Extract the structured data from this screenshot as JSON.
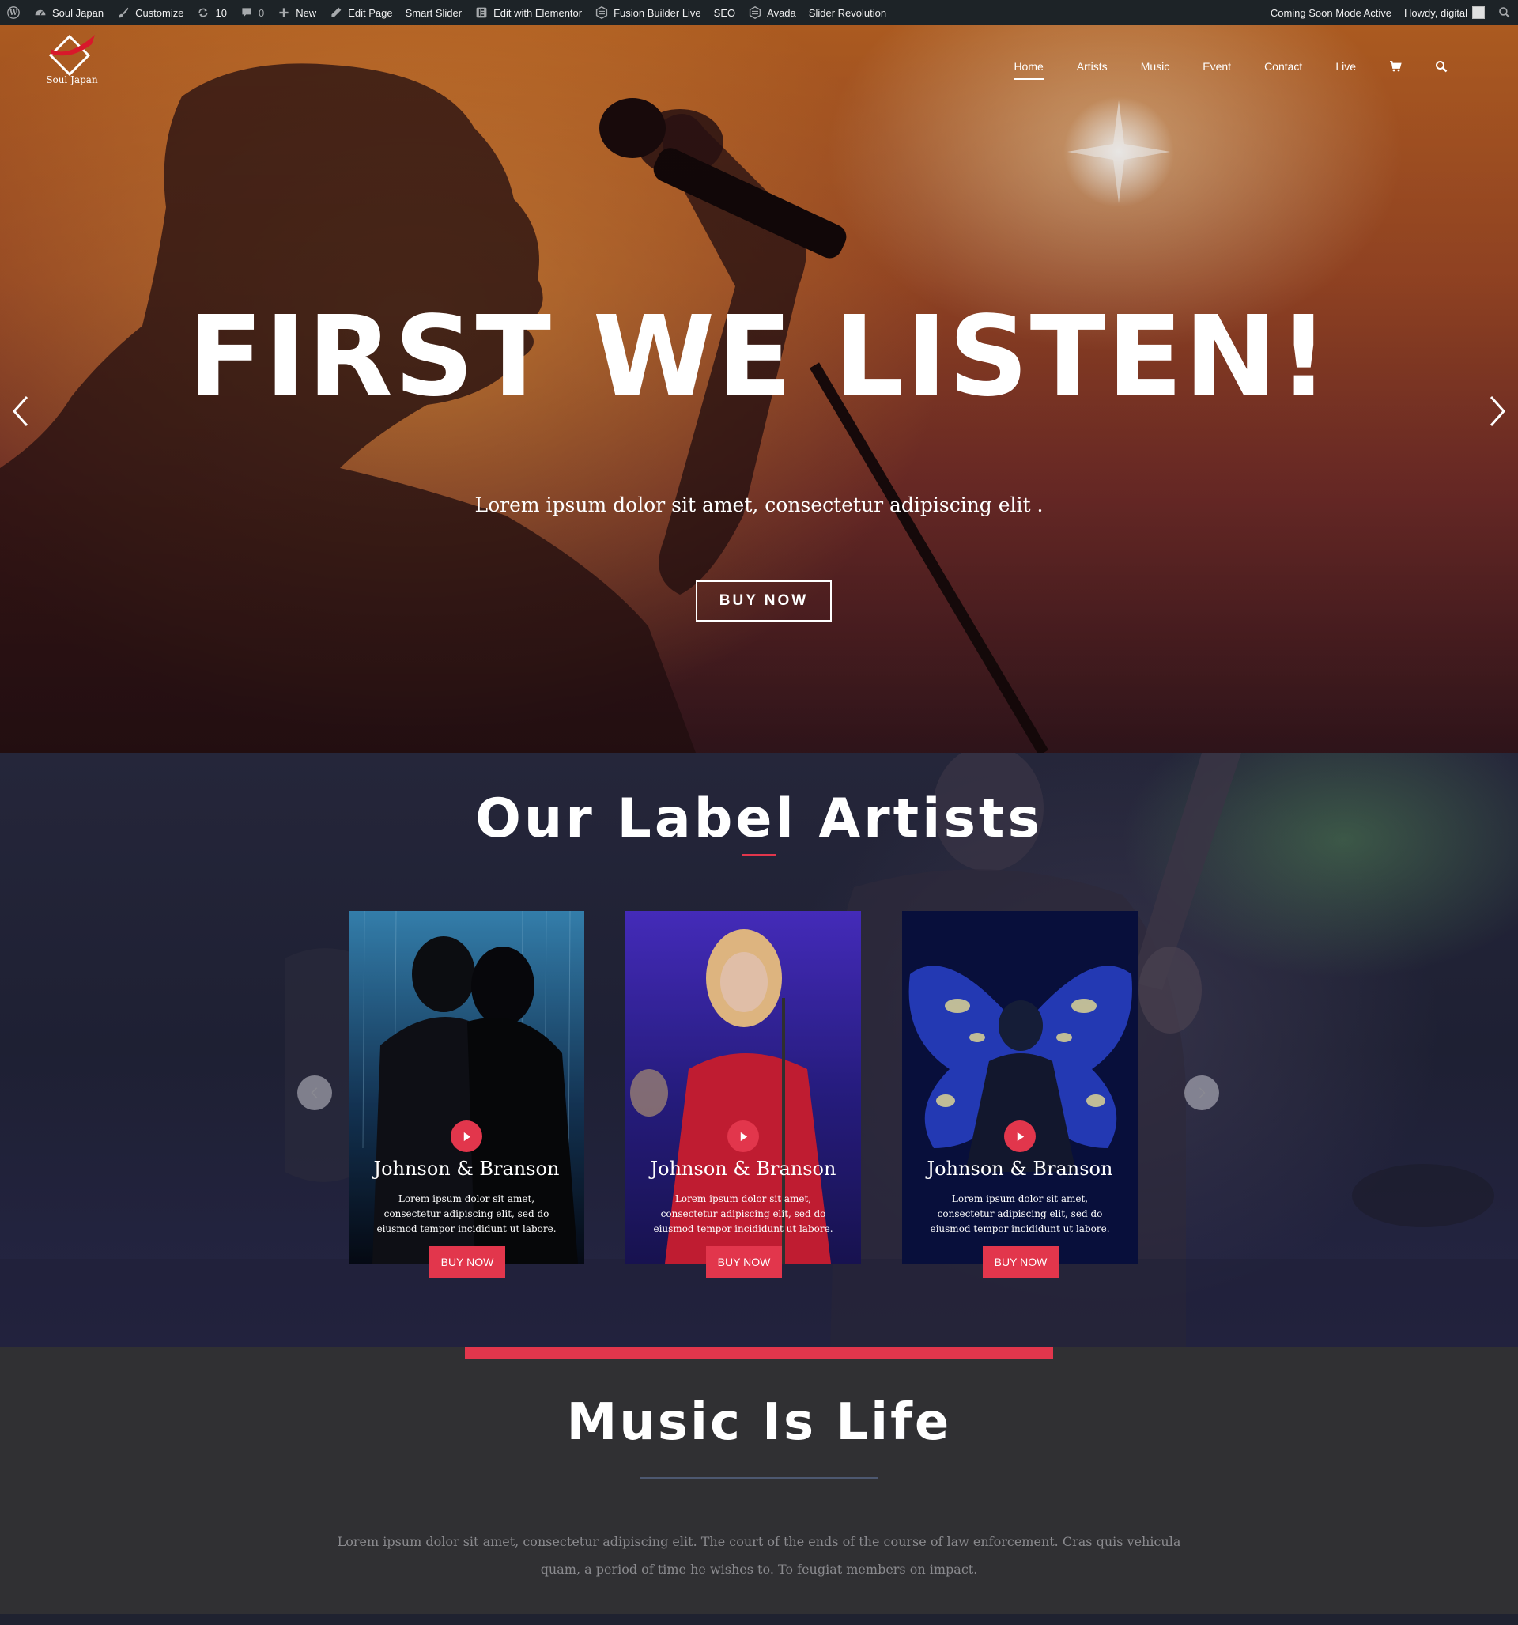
{
  "adminbar": {
    "site_name": "Soul Japan",
    "customize": "Customize",
    "updates_count": "10",
    "comments_count": "0",
    "new": "New",
    "edit_page": "Edit Page",
    "smart_slider": "Smart Slider",
    "edit_elementor": "Edit with Elementor",
    "fusion_builder": "Fusion Builder Live",
    "seo": "SEO",
    "avada": "Avada",
    "slider_revolution": "Slider Revolution",
    "coming_soon": "Coming Soon Mode Active",
    "howdy": "Howdy, digital"
  },
  "logo": {
    "text": "Soul Japan"
  },
  "nav": {
    "items": [
      {
        "label": "Home"
      },
      {
        "label": "Artists"
      },
      {
        "label": "Music"
      },
      {
        "label": "Event"
      },
      {
        "label": "Contact"
      },
      {
        "label": "Live"
      }
    ]
  },
  "hero": {
    "title": "FIRST WE LISTEN!",
    "subtitle": "Lorem ipsum dolor sit amet, consectetur adipiscing elit .",
    "button": "BUY NOW"
  },
  "artists": {
    "title": "Our Label Artists",
    "cards": [
      {
        "name": "Johnson & Branson",
        "desc": "Lorem ipsum dolor sit amet, consectetur adipiscing elit, sed do eiusmod tempor incididunt ut labore.",
        "button": "BUY NOW"
      },
      {
        "name": "Johnson & Branson",
        "desc": "Lorem ipsum dolor sit amet, consectetur adipiscing elit, sed do eiusmod tempor incididunt ut labore.",
        "button": "BUY NOW"
      },
      {
        "name": "Johnson & Branson",
        "desc": "Lorem ipsum dolor sit amet, consectetur adipiscing elit, sed do eiusmod tempor incididunt ut labore.",
        "button": "BUY NOW"
      }
    ]
  },
  "music": {
    "title": "Music Is Life",
    "text": "Lorem ipsum dolor sit amet, consectetur adipiscing elit. The court of the ends of the course of law enforcement. Cras quis vehicula quam, a period of time he wishes to. To feugiat members on impact."
  },
  "colors": {
    "accent": "#e2364c",
    "adminbar": "#1d2327",
    "music_bg": "#303033"
  }
}
